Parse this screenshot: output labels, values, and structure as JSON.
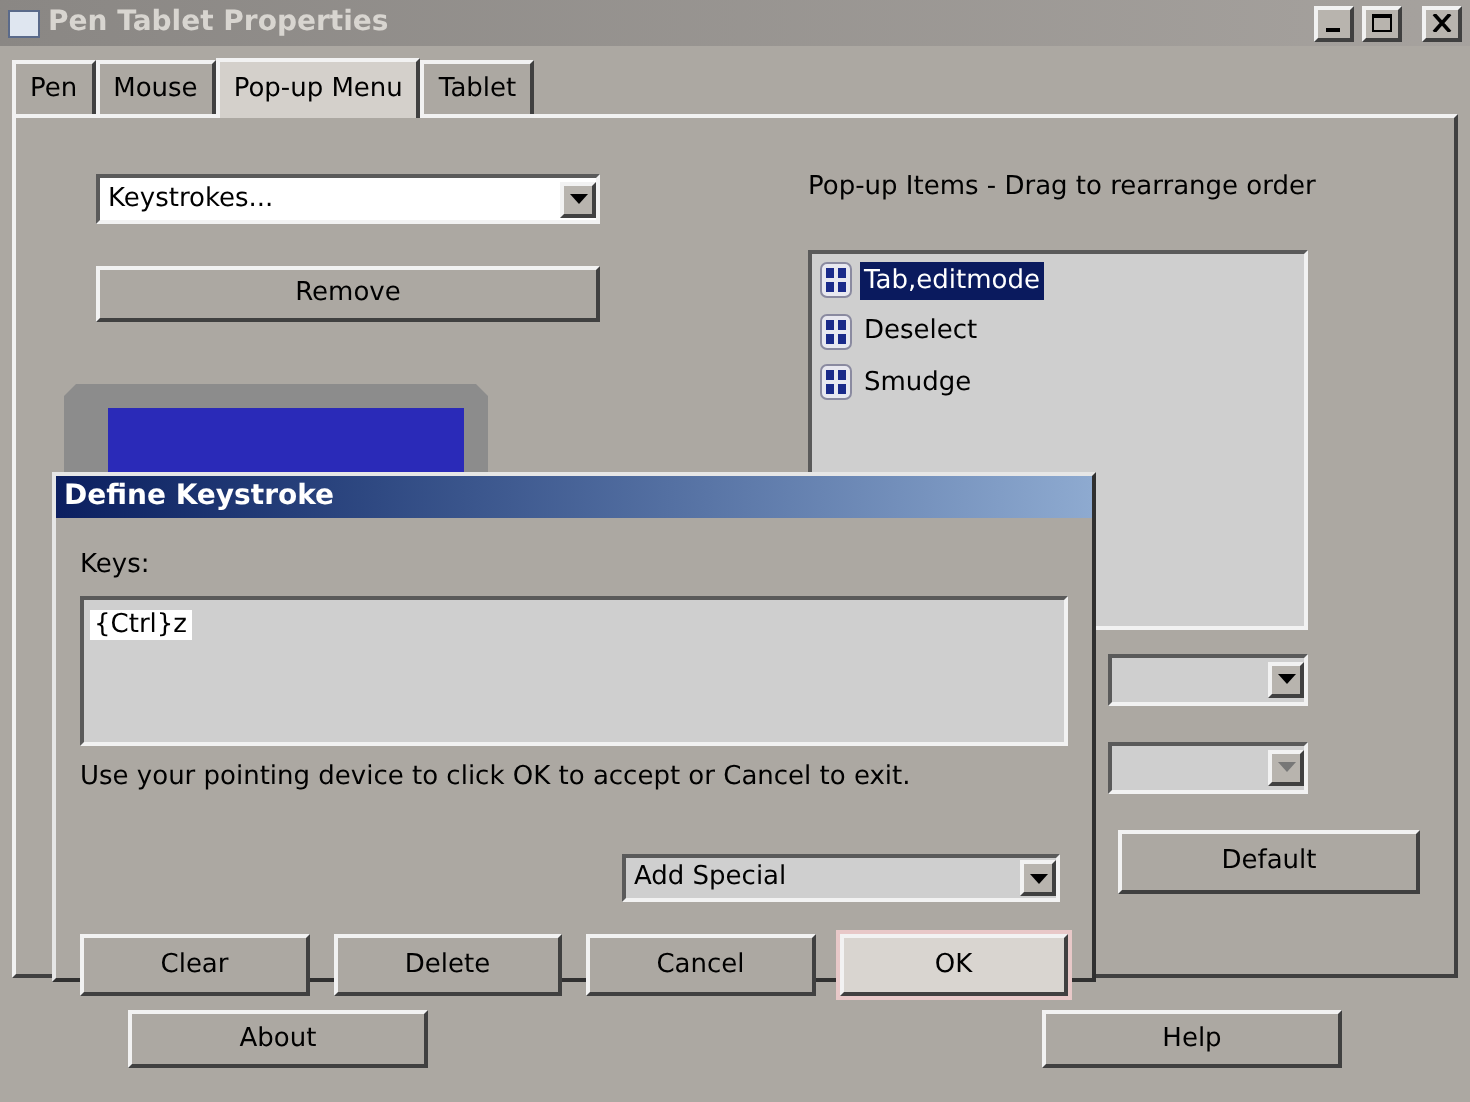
{
  "window": {
    "title": "Pen Tablet Properties"
  },
  "tabs": [
    {
      "label": "Pen",
      "selected": false
    },
    {
      "label": "Mouse",
      "selected": false
    },
    {
      "label": "Pop-up Menu",
      "selected": true
    },
    {
      "label": "Tablet",
      "selected": false
    }
  ],
  "function_dropdown": {
    "value": "Keystrokes..."
  },
  "remove_button": "Remove",
  "popup_items": {
    "label": "Pop-up Items - Drag to rearrange order",
    "items": [
      {
        "label": "Tab,editmode",
        "selected": true
      },
      {
        "label": "Deselect",
        "selected": false
      },
      {
        "label": "Smudge",
        "selected": false
      }
    ]
  },
  "default_button": "Default",
  "bottom_buttons": [
    "About",
    "Help"
  ],
  "dialog": {
    "title": "Define Keystroke",
    "keys_label": "Keys:",
    "keys_value": "{Ctrl}z",
    "instruction": "Use your pointing device to click OK to accept or Cancel to exit.",
    "add_special": "Add Special",
    "buttons": [
      {
        "label": "Clear",
        "default": false
      },
      {
        "label": "Delete",
        "default": false
      },
      {
        "label": "Cancel",
        "default": false
      },
      {
        "label": "OK",
        "default": true
      }
    ]
  }
}
